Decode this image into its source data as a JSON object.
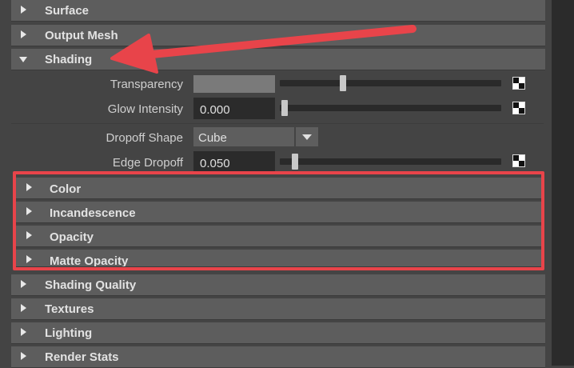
{
  "sections_top": [
    {
      "label": "Surface",
      "expanded": false
    },
    {
      "label": "Output Mesh",
      "expanded": false
    },
    {
      "label": "Shading",
      "expanded": true
    }
  ],
  "shading": {
    "transparency_label": "Transparency",
    "transparency_slider_fraction": 0.27,
    "glow_label": "Glow Intensity",
    "glow_value": "0.000",
    "glow_slider_fraction": 0.0,
    "dropoff_shape_label": "Dropoff Shape",
    "dropoff_shape_value": "Cube",
    "edge_dropoff_label": "Edge Dropoff",
    "edge_dropoff_value": "0.050",
    "edge_dropoff_slider_fraction": 0.05
  },
  "subsections": [
    {
      "label": "Color"
    },
    {
      "label": "Incandescence"
    },
    {
      "label": "Opacity"
    },
    {
      "label": "Matte Opacity"
    }
  ],
  "sections_bottom": [
    {
      "label": "Shading Quality"
    },
    {
      "label": "Textures"
    },
    {
      "label": "Lighting"
    },
    {
      "label": "Render Stats"
    }
  ],
  "annotation": {
    "arrow_color": "#e8444a",
    "highlight_color": "#e8444a"
  },
  "icons": {
    "map_button": "checker-map-icon",
    "collapsed": "triangle-right-icon",
    "expanded": "triangle-down-icon"
  }
}
